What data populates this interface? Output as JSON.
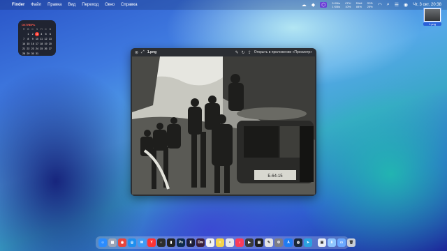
{
  "menubar": {
    "app_name": "Finder",
    "menus": [
      "Файл",
      "Правка",
      "Вид",
      "Переход",
      "Окно",
      "Справка"
    ],
    "net_up": "5 KB/s",
    "net_down": "1 KB/s",
    "cpu_label": "CPU",
    "cpu_value": "10%",
    "ram_label": "RAM",
    "ram_value": "84%",
    "bat_label": "SSD",
    "bat_value": "25%",
    "datetime": "Чт, 3 окт. 20:38"
  },
  "calendar": {
    "month": "ОКТЯБРЬ",
    "weekdays": [
      "П",
      "В",
      "С",
      "Ч",
      "П",
      "С",
      "В"
    ],
    "days": [
      "",
      "1",
      "2",
      "3",
      "4",
      "5",
      "6",
      "7",
      "8",
      "9",
      "10",
      "11",
      "12",
      "13",
      "14",
      "15",
      "16",
      "17",
      "18",
      "19",
      "20",
      "21",
      "22",
      "23",
      "24",
      "25",
      "26",
      "27",
      "28",
      "29",
      "30",
      "31",
      "",
      "",
      ""
    ],
    "today": "3"
  },
  "desktop_file": {
    "name": "1.png"
  },
  "preview": {
    "filename": "1.png",
    "open_in": "Открыть в приложении «Просмотр»",
    "vehicle_plate": "Б-64-15"
  },
  "dock": {
    "apps": [
      {
        "name": "finder",
        "glyph": "☺",
        "color": "#2a8cff"
      },
      {
        "name": "launchpad",
        "glyph": "▦",
        "color": "#9aa4b8"
      },
      {
        "name": "chrome",
        "glyph": "◉",
        "color": "#e8453c"
      },
      {
        "name": "safari",
        "glyph": "◎",
        "color": "#1d8ff0"
      },
      {
        "name": "mail",
        "glyph": "✉",
        "color": "#3e9cf5"
      },
      {
        "name": "yandex",
        "glyph": "Y",
        "color": "#ff3333"
      },
      {
        "name": "vpn",
        "glyph": "◐",
        "color": "#2d2d2d"
      },
      {
        "name": "terminal",
        "glyph": "▮",
        "color": "#222"
      },
      {
        "name": "photoshop",
        "glyph": "Ps",
        "color": "#0f2a4a"
      },
      {
        "name": "lightroom",
        "glyph": "♜",
        "color": "#1f1f3a"
      },
      {
        "name": "dreamweaver",
        "glyph": "Dw",
        "color": "#3a1e3a"
      },
      {
        "name": "calendar",
        "glyph": "3",
        "color": "#f2f2f2"
      },
      {
        "name": "notes",
        "glyph": "≡",
        "color": "#f5d34a"
      },
      {
        "name": "reminders",
        "glyph": "•",
        "color": "#e8e8e8"
      },
      {
        "name": "music",
        "glyph": "♪",
        "color": "#fa3c5a"
      },
      {
        "name": "video-player",
        "glyph": "▶",
        "color": "#3b3b3b"
      },
      {
        "name": "activity-monitor",
        "glyph": "▤",
        "color": "#1f1f1f"
      },
      {
        "name": "textedit",
        "glyph": "✎",
        "color": "#e5e5e5"
      },
      {
        "name": "system-settings",
        "glyph": "⚙",
        "color": "#7d7d85"
      },
      {
        "name": "app-store",
        "glyph": "A",
        "color": "#1e7cf2"
      },
      {
        "name": "steam",
        "glyph": "◍",
        "color": "#1b2838"
      },
      {
        "name": "telegram",
        "glyph": "➤",
        "color": "#2aa1e0"
      }
    ],
    "recent": [
      {
        "name": "preview",
        "glyph": "▣",
        "color": "#e9eef6"
      },
      {
        "name": "downloads-folder",
        "glyph": "⬇",
        "color": "#8fc6ff"
      },
      {
        "name": "screenshot",
        "glyph": "▭",
        "color": "#6aa8ff"
      },
      {
        "name": "trash",
        "glyph": "🗑",
        "color": "#c9ced6"
      }
    ]
  }
}
